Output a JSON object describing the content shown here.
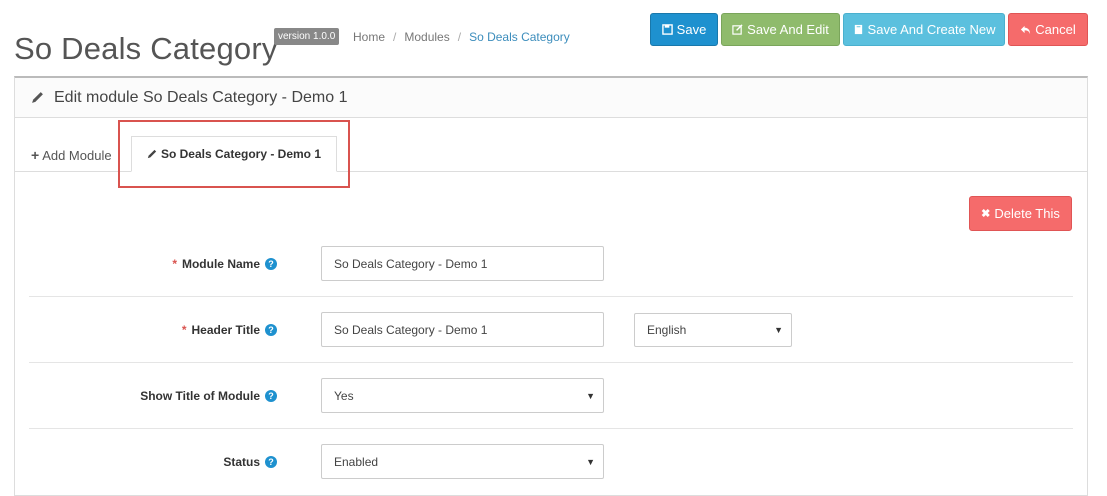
{
  "header": {
    "title": "So Deals Category",
    "version": "version 1.0.0",
    "breadcrumb": [
      "Home",
      "Modules",
      "So Deals Category"
    ]
  },
  "toolbar": {
    "save_label": "Save",
    "save_edit_label": "Save And Edit",
    "save_new_label": "Save And Create New",
    "cancel_label": "Cancel"
  },
  "panel": {
    "heading": "Edit module So Deals Category - Demo 1",
    "tabs": {
      "add_label": "Add Module",
      "active_label": "So Deals Category - Demo 1"
    },
    "delete_label": "Delete This"
  },
  "form": {
    "module_name": {
      "label": "Module Name",
      "required": "*",
      "value": "So Deals Category - Demo 1"
    },
    "header_title": {
      "label": "Header Title",
      "required": "*",
      "value": "So Deals Category - Demo 1",
      "language": "English"
    },
    "show_title": {
      "label": "Show Title of Module",
      "value": "Yes"
    },
    "status": {
      "label": "Status",
      "value": "Enabled"
    }
  },
  "colors": {
    "primary": "#1e91cf",
    "success": "#8fbb6c",
    "info": "#5bc0de",
    "danger": "#f56b6b"
  }
}
